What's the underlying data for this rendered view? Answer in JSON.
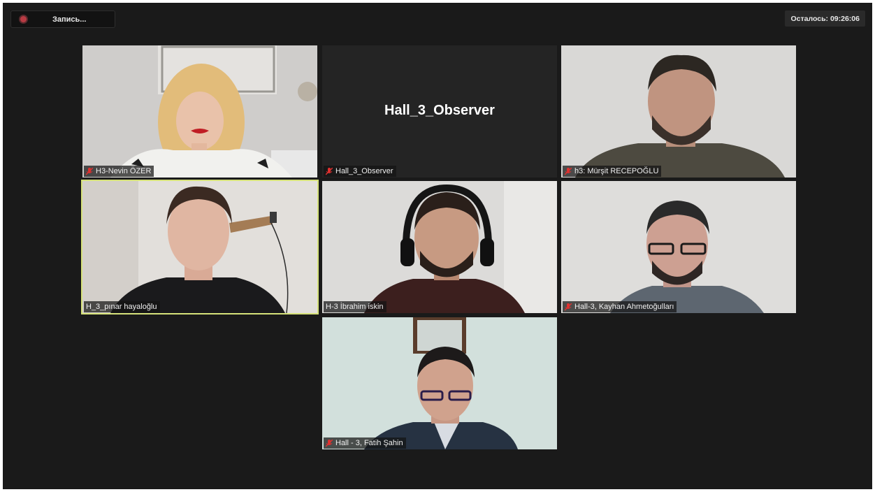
{
  "recording": {
    "label": "Запись..."
  },
  "timer": {
    "label": "Осталось: 09:26:06"
  },
  "participants": [
    {
      "name": "H3-Nevin ÖZER",
      "muted": true
    },
    {
      "name": "Hall_3_Observer",
      "muted": true,
      "display_name": "Hall_3_Observer"
    },
    {
      "name": "h3: Mürşit RECEPOĞLU",
      "muted": true
    },
    {
      "name": "H_3_pınar hayaloğlu",
      "muted": false,
      "active_speaker": true
    },
    {
      "name": "H-3 İbrahim iskin",
      "muted": false
    },
    {
      "name": "Hall-3, Kayhan Ahmetoğulları",
      "muted": true
    },
    {
      "name": "Hall - 3, Fatih Şahin",
      "muted": true
    }
  ],
  "colors": {
    "active_border": "#d6e27a",
    "muted_icon": "#e0302f",
    "background": "#1a1a1a"
  }
}
